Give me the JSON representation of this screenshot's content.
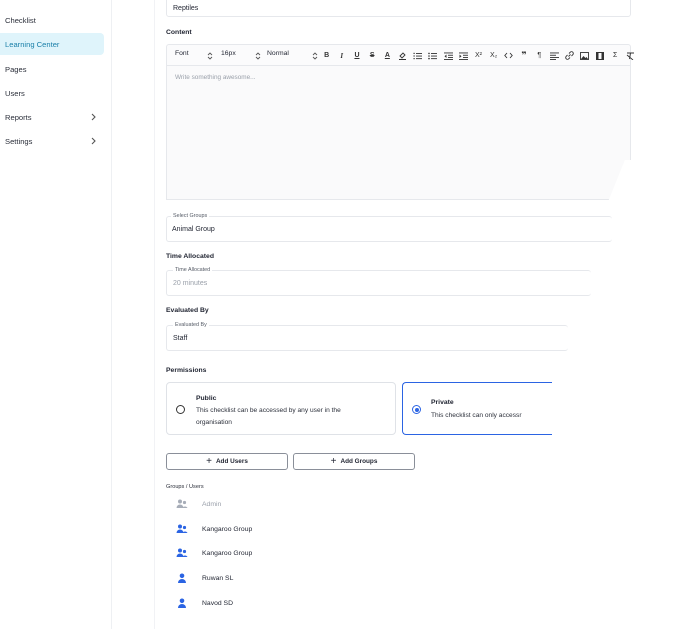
{
  "sidebar": {
    "items": [
      {
        "label": "Checklist",
        "active": false,
        "chevron": false
      },
      {
        "label": "Learning Center",
        "active": true,
        "chevron": false
      },
      {
        "label": "Pages",
        "active": false,
        "chevron": false
      },
      {
        "label": "Users",
        "active": false,
        "chevron": false
      },
      {
        "label": "Reports",
        "active": false,
        "chevron": true
      },
      {
        "label": "Settings",
        "active": false,
        "chevron": true
      }
    ]
  },
  "form": {
    "category_value": "Reptiles",
    "content_label": "Content",
    "toolbar": {
      "font": "Font",
      "size": "16px",
      "style": "Normal",
      "icons": [
        "bold-icon",
        "italic-icon",
        "underline-icon",
        "strike-icon",
        "font-color-icon",
        "highlight-icon",
        "ordered-list-icon",
        "bullet-list-icon",
        "outdent-icon",
        "indent-icon",
        "superscript-icon",
        "subscript-icon",
        "code-icon",
        "quote-icon",
        "direction-icon",
        "align-icon",
        "link-icon",
        "image-icon",
        "video-icon",
        "formula-icon",
        "clear-format-icon"
      ]
    },
    "editor_placeholder": "Write something awesome...",
    "select_groups": {
      "float_label": "Select Groups",
      "value": "Animal Group"
    },
    "time_allocated": {
      "label": "Time Allocated",
      "float_label": "Time Allocated",
      "value": "20 minutes"
    },
    "evaluated_by": {
      "label": "Evaluated By",
      "float_label": "Evaluated By",
      "value": "Staff"
    },
    "permissions": {
      "label": "Permissions",
      "public": {
        "title": "Public",
        "desc_line1": "This checklist can be accessed by any user in the",
        "desc_line2": "organisation",
        "selected": false
      },
      "private": {
        "title": "Private",
        "desc": "This checklist can only accessr",
        "selected": true
      }
    },
    "add_users_label": "Add Users",
    "add_groups_label": "Add Groups",
    "groups_users_label": "Groups / Users",
    "members": [
      {
        "name": "Admin",
        "type": "group",
        "muted": true
      },
      {
        "name": "Kangaroo Group",
        "type": "group",
        "muted": false
      },
      {
        "name": "Kangaroo Group",
        "type": "group",
        "muted": false
      },
      {
        "name": "Ruwan SL",
        "type": "user",
        "muted": false
      },
      {
        "name": "Navod SD",
        "type": "user",
        "muted": false
      }
    ]
  },
  "colors": {
    "accent": "#2b64e3",
    "active_nav_bg": "#dff4fb",
    "active_nav_text": "#1a7fa8"
  }
}
